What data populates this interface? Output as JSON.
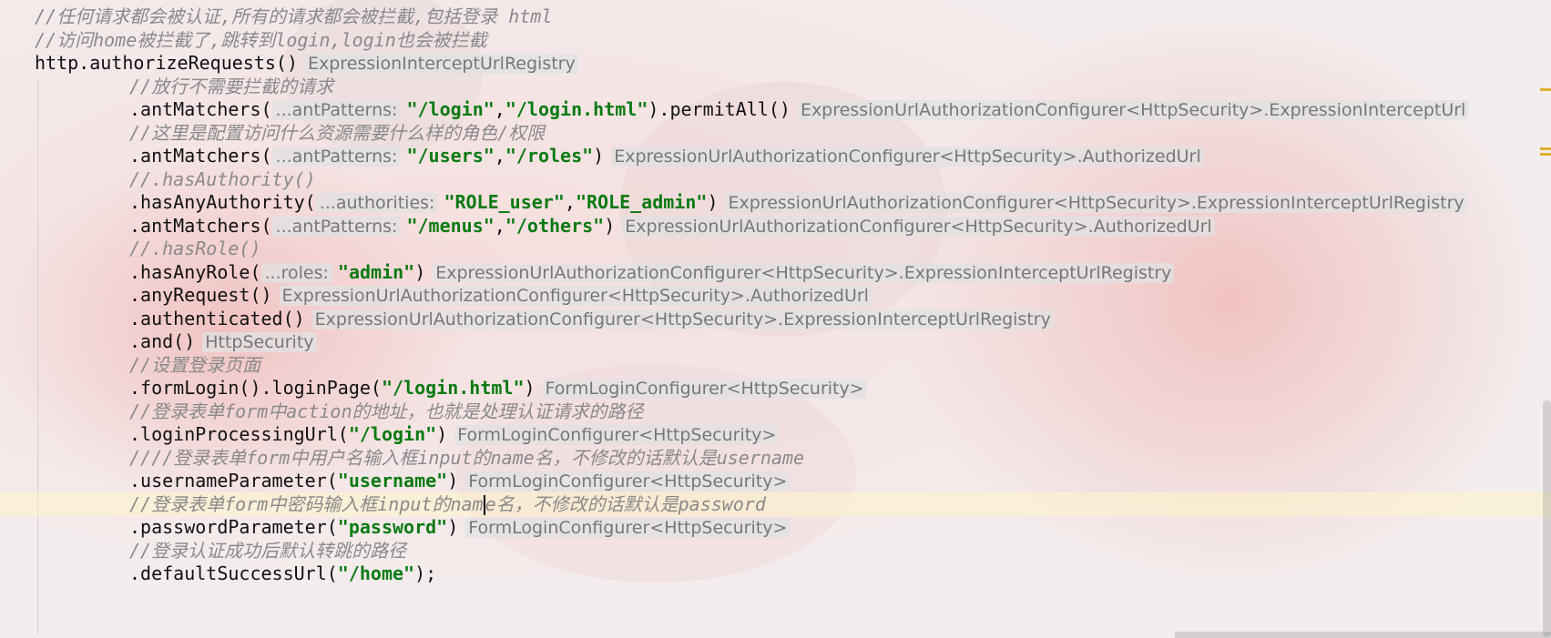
{
  "editor": {
    "language": "java",
    "lines": [
      {
        "indent": 0,
        "parts": [
          {
            "t": "comment",
            "v": "//任何请求都会被认证,所有的请求都会被拦截,包括登录  html"
          }
        ]
      },
      {
        "indent": 0,
        "parts": [
          {
            "t": "comment",
            "v": "//访问home被拦截了,跳转到login,login也会被拦截"
          }
        ]
      },
      {
        "indent": 0,
        "parts": [
          {
            "t": "code",
            "v": "http.authorizeRequests()"
          },
          {
            "t": "type",
            "v": "ExpressionInterceptUrlRegistry"
          }
        ]
      },
      {
        "indent": 1,
        "parts": [
          {
            "t": "comment",
            "v": "//放行不需要拦截的请求"
          }
        ]
      },
      {
        "indent": 1,
        "parts": [
          {
            "t": "code",
            "v": ".antMatchers("
          },
          {
            "t": "pname",
            "v": "...antPatterns:"
          },
          {
            "t": "str",
            "v": "\"/login\""
          },
          {
            "t": "code",
            "v": ","
          },
          {
            "t": "str",
            "v": "\"/login.html\""
          },
          {
            "t": "code",
            "v": ").permitAll()"
          },
          {
            "t": "type",
            "v": "ExpressionUrlAuthorizationConfigurer<HttpSecurity>.ExpressionInterceptUrl"
          }
        ]
      },
      {
        "indent": 1,
        "parts": [
          {
            "t": "comment",
            "v": "//这里是配置访问什么资源需要什么样的角色/权限"
          }
        ]
      },
      {
        "indent": 1,
        "parts": [
          {
            "t": "code",
            "v": ".antMatchers("
          },
          {
            "t": "pname",
            "v": "...antPatterns:"
          },
          {
            "t": "str",
            "v": "\"/users\""
          },
          {
            "t": "code",
            "v": ","
          },
          {
            "t": "str",
            "v": "\"/roles\""
          },
          {
            "t": "code",
            "v": ")"
          },
          {
            "t": "type",
            "v": "ExpressionUrlAuthorizationConfigurer<HttpSecurity>.AuthorizedUrl"
          }
        ]
      },
      {
        "indent": 1,
        "parts": [
          {
            "t": "comment",
            "v": "//.hasAuthority()"
          }
        ]
      },
      {
        "indent": 1,
        "parts": [
          {
            "t": "code",
            "v": ".hasAnyAuthority("
          },
          {
            "t": "pname",
            "v": "...authorities:"
          },
          {
            "t": "str",
            "v": "\"ROLE_user\""
          },
          {
            "t": "code",
            "v": ","
          },
          {
            "t": "str",
            "v": "\"ROLE_admin\""
          },
          {
            "t": "code",
            "v": ")"
          },
          {
            "t": "type",
            "v": "ExpressionUrlAuthorizationConfigurer<HttpSecurity>.ExpressionInterceptUrlRegistry"
          }
        ]
      },
      {
        "indent": 1,
        "parts": [
          {
            "t": "code",
            "v": ".antMatchers("
          },
          {
            "t": "pname",
            "v": "...antPatterns:"
          },
          {
            "t": "str",
            "v": "\"/menus\""
          },
          {
            "t": "code",
            "v": ","
          },
          {
            "t": "str",
            "v": "\"/others\""
          },
          {
            "t": "code",
            "v": ")"
          },
          {
            "t": "type",
            "v": "ExpressionUrlAuthorizationConfigurer<HttpSecurity>.AuthorizedUrl"
          }
        ]
      },
      {
        "indent": 1,
        "parts": [
          {
            "t": "comment",
            "v": "//.hasRole()"
          }
        ]
      },
      {
        "indent": 1,
        "parts": [
          {
            "t": "code",
            "v": ".hasAnyRole("
          },
          {
            "t": "pname",
            "v": "...roles:"
          },
          {
            "t": "str",
            "v": "\"admin\""
          },
          {
            "t": "code",
            "v": ")"
          },
          {
            "t": "type",
            "v": "ExpressionUrlAuthorizationConfigurer<HttpSecurity>.ExpressionInterceptUrlRegistry"
          }
        ]
      },
      {
        "indent": 1,
        "parts": [
          {
            "t": "code",
            "v": ".anyRequest()"
          },
          {
            "t": "type",
            "v": "ExpressionUrlAuthorizationConfigurer<HttpSecurity>.AuthorizedUrl"
          }
        ]
      },
      {
        "indent": 1,
        "parts": [
          {
            "t": "code",
            "v": ".authenticated()"
          },
          {
            "t": "type",
            "v": "ExpressionUrlAuthorizationConfigurer<HttpSecurity>.ExpressionInterceptUrlRegistry"
          }
        ]
      },
      {
        "indent": 1,
        "parts": [
          {
            "t": "code",
            "v": ".and()"
          },
          {
            "t": "type",
            "v": "HttpSecurity"
          }
        ]
      },
      {
        "indent": 1,
        "parts": [
          {
            "t": "comment",
            "v": "//设置登录页面"
          }
        ]
      },
      {
        "indent": 1,
        "parts": [
          {
            "t": "code",
            "v": ".formLogin().loginPage("
          },
          {
            "t": "str",
            "v": "\"/login.html\""
          },
          {
            "t": "code",
            "v": ")"
          },
          {
            "t": "type",
            "v": "FormLoginConfigurer<HttpSecurity>"
          }
        ]
      },
      {
        "indent": 1,
        "parts": [
          {
            "t": "comment",
            "v": "//登录表单form中action的地址，也就是处理认证请求的路径"
          }
        ]
      },
      {
        "indent": 1,
        "parts": [
          {
            "t": "code",
            "v": ".loginProcessingUrl("
          },
          {
            "t": "str",
            "v": "\"/login\""
          },
          {
            "t": "code",
            "v": ")"
          },
          {
            "t": "type",
            "v": "FormLoginConfigurer<HttpSecurity>"
          }
        ]
      },
      {
        "indent": 1,
        "parts": [
          {
            "t": "comment",
            "v": "////登录表单form中用户名输入框input的name名，不修改的话默认是username"
          }
        ]
      },
      {
        "indent": 1,
        "parts": [
          {
            "t": "code",
            "v": ".usernameParameter("
          },
          {
            "t": "str",
            "v": "\"username\""
          },
          {
            "t": "code",
            "v": ")"
          },
          {
            "t": "type",
            "v": "FormLoginConfigurer<HttpSecurity>"
          }
        ]
      },
      {
        "indent": 1,
        "caret": true,
        "parts": [
          {
            "t": "comment",
            "v": "//登录表单form中密码输入框input的nam"
          },
          {
            "t": "caret",
            "v": ""
          },
          {
            "t": "comment",
            "v": "e名，不修改的话默认是password"
          }
        ]
      },
      {
        "indent": 1,
        "parts": [
          {
            "t": "code",
            "v": ".passwordParameter("
          },
          {
            "t": "str",
            "v": "\"password\""
          },
          {
            "t": "code",
            "v": ")"
          },
          {
            "t": "type",
            "v": "FormLoginConfigurer<HttpSecurity>"
          }
        ]
      },
      {
        "indent": 1,
        "parts": [
          {
            "t": "comment",
            "v": "//登录认证成功后默认转跳的路径"
          }
        ]
      },
      {
        "indent": 1,
        "parts": [
          {
            "t": "code",
            "v": ".defaultSuccessUrl("
          },
          {
            "t": "str",
            "v": "\"/home\""
          },
          {
            "t": "code",
            "v": ");"
          }
        ]
      }
    ]
  },
  "colors": {
    "string": "#0a7a12",
    "comment": "#8a8a8a",
    "hint": "#777777",
    "caret_line": "#fff4c8",
    "marker": "#e0b030"
  }
}
